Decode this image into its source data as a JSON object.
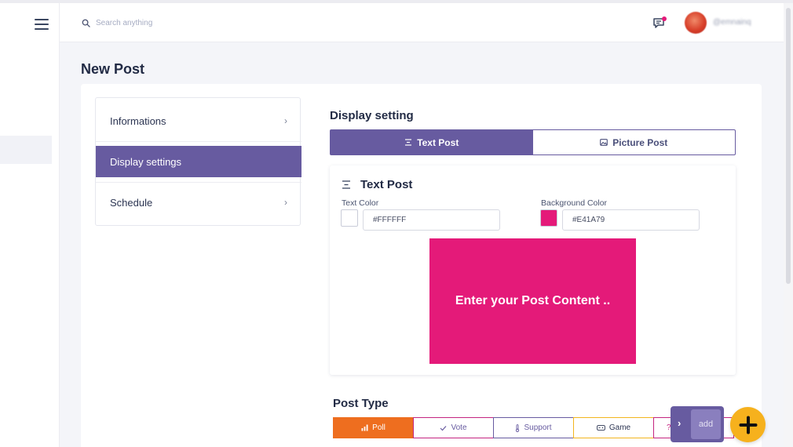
{
  "header": {
    "search_placeholder": "Search anything",
    "username": "@emnainq"
  },
  "page": {
    "title": "New Post"
  },
  "steps": [
    {
      "label": "Informations",
      "active": false
    },
    {
      "label": "Display settings",
      "active": true
    },
    {
      "label": "Schedule",
      "active": false
    }
  ],
  "display": {
    "title": "Display setting",
    "tabs": [
      {
        "label": "Text Post",
        "icon": "align-center-icon",
        "active": true
      },
      {
        "label": "Picture Post",
        "icon": "image-icon",
        "active": false
      }
    ]
  },
  "text_post": {
    "title": "Text Post",
    "text_color_label": "Text Color",
    "text_color_value": "#FFFFFF",
    "bg_color_label": "Background Color",
    "bg_color_value": "#E41A79",
    "preview_placeholder": "Enter your Post Content .."
  },
  "post_type": {
    "title": "Post Type",
    "options": [
      {
        "label": "Poll",
        "icon": "bar-chart-icon",
        "active": true
      },
      {
        "label": "Vote",
        "icon": "check-icon",
        "active": false
      },
      {
        "label": "Support",
        "icon": "thermometer-icon",
        "active": false
      },
      {
        "label": "Game",
        "icon": "gamepad-icon",
        "active": false
      },
      {
        "label": "?",
        "icon": "",
        "active": false
      }
    ]
  },
  "floating": {
    "add_label": "add"
  },
  "colors": {
    "accent": "#675BA0",
    "post_bg": "#E41A79",
    "post_text": "#FFFFFF",
    "poll_active": "#EE6E1F",
    "vote_border": "#C42580",
    "support_border": "#675BA0",
    "game_border": "#F2B51E",
    "fab": "#F6B11D"
  }
}
